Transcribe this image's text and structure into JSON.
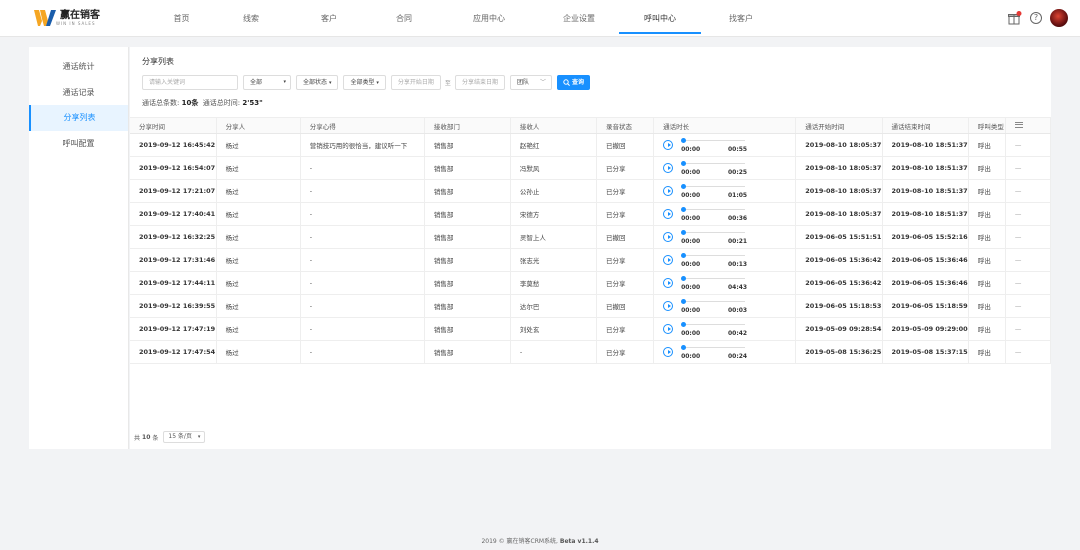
{
  "colors": {
    "accent": "#1890ff",
    "logo_orange": "#f5a623",
    "logo_blue": "#1a5dab"
  },
  "logo": {
    "name": "赢在销客",
    "sub": "WIN IN SALES"
  },
  "nav": [
    {
      "label": "首页"
    },
    {
      "label": "线索"
    },
    {
      "label": "客户"
    },
    {
      "label": "合同"
    },
    {
      "label": "应用中心"
    },
    {
      "label": "企业设置"
    },
    {
      "label": "呼叫中心",
      "active": true
    },
    {
      "label": "找客户"
    }
  ],
  "topbar_icons": [
    "gift-icon",
    "help-icon",
    "avatar"
  ],
  "sidebar": [
    {
      "label": "通话统计"
    },
    {
      "label": "通话记录"
    },
    {
      "label": "分享列表",
      "active": true
    },
    {
      "label": "呼叫配置"
    }
  ],
  "page_title": "分享列表",
  "filters": {
    "keyword_placeholder": "请输入关键词",
    "scope": "全部",
    "status": "全部状态",
    "type": "全部类型",
    "start_date_placeholder": "分享开始日期",
    "to": "至",
    "end_date_placeholder": "分享结束日期",
    "team": "团队",
    "search_button": "查询"
  },
  "summary": {
    "count_label": "通话总条数:",
    "count": "10条",
    "time_label": "通话总时间:",
    "time": "2'53\""
  },
  "table": {
    "headers": [
      "分享时间",
      "分享人",
      "分享心得",
      "接收部门",
      "接收人",
      "录音状态",
      "通话时长",
      "通话开始时间",
      "通话结束时间",
      "呼叫类型"
    ],
    "rows": [
      {
        "time": "2019-09-12 16:45:42",
        "sharer": "杨过",
        "note": "营销技巧用的很恰当，建议听一下",
        "dept": "销售部",
        "receiver": "赵艳红",
        "status": "已撤回",
        "cur": "00:00",
        "dur": "00:55",
        "start": "2019-08-10 18:05:37",
        "end": "2019-08-10 18:51:37",
        "calltype": "呼出",
        "op": "—"
      },
      {
        "time": "2019-09-12 16:54:07",
        "sharer": "杨过",
        "note": "-",
        "dept": "销售部",
        "receiver": "冯默风",
        "status": "已分享",
        "cur": "00:00",
        "dur": "00:25",
        "start": "2019-08-10 18:05:37",
        "end": "2019-08-10 18:51:37",
        "calltype": "呼出",
        "op": "—"
      },
      {
        "time": "2019-09-12 17:21:07",
        "sharer": "杨过",
        "note": "-",
        "dept": "销售部",
        "receiver": "公孙止",
        "status": "已分享",
        "cur": "00:00",
        "dur": "01:05",
        "start": "2019-08-10 18:05:37",
        "end": "2019-08-10 18:51:37",
        "calltype": "呼出",
        "op": "—"
      },
      {
        "time": "2019-09-12 17:40:41",
        "sharer": "杨过",
        "note": "-",
        "dept": "销售部",
        "receiver": "宋德方",
        "status": "已分享",
        "cur": "00:00",
        "dur": "00:36",
        "start": "2019-08-10 18:05:37",
        "end": "2019-08-10 18:51:37",
        "calltype": "呼出",
        "op": "—"
      },
      {
        "time": "2019-09-12 16:32:25",
        "sharer": "杨过",
        "note": "-",
        "dept": "销售部",
        "receiver": "灵智上人",
        "status": "已撤回",
        "cur": "00:00",
        "dur": "00:21",
        "start": "2019-06-05 15:51:51",
        "end": "2019-06-05 15:52:16",
        "calltype": "呼出",
        "op": "—"
      },
      {
        "time": "2019-09-12 17:31:46",
        "sharer": "杨过",
        "note": "-",
        "dept": "销售部",
        "receiver": "张志光",
        "status": "已分享",
        "cur": "00:00",
        "dur": "00:13",
        "start": "2019-06-05 15:36:42",
        "end": "2019-06-05 15:36:46",
        "calltype": "呼出",
        "op": "—"
      },
      {
        "time": "2019-09-12 17:44:11",
        "sharer": "杨过",
        "note": "-",
        "dept": "销售部",
        "receiver": "李莫愁",
        "status": "已分享",
        "cur": "00:00",
        "dur": "04:43",
        "start": "2019-06-05 15:36:42",
        "end": "2019-06-05 15:36:46",
        "calltype": "呼出",
        "op": "—"
      },
      {
        "time": "2019-09-12 16:39:55",
        "sharer": "杨过",
        "note": "-",
        "dept": "销售部",
        "receiver": "达尔巴",
        "status": "已撤回",
        "cur": "00:00",
        "dur": "00:03",
        "start": "2019-06-05 15:18:53",
        "end": "2019-06-05 15:18:59",
        "calltype": "呼出",
        "op": "—"
      },
      {
        "time": "2019-09-12 17:47:19",
        "sharer": "杨过",
        "note": "-",
        "dept": "销售部",
        "receiver": "刘处玄",
        "status": "已分享",
        "cur": "00:00",
        "dur": "00:42",
        "start": "2019-05-09 09:28:54",
        "end": "2019-05-09 09:29:00",
        "calltype": "呼出",
        "op": "—"
      },
      {
        "time": "2019-09-12 17:47:54",
        "sharer": "杨过",
        "note": "-",
        "dept": "销售部",
        "receiver": "-",
        "status": "已分享",
        "cur": "00:00",
        "dur": "00:24",
        "start": "2019-05-08 15:36:25",
        "end": "2019-05-08 15:37:15",
        "calltype": "呼出",
        "op": "—"
      }
    ]
  },
  "pager": {
    "prefix": "共",
    "total": "10",
    "suffix": "条",
    "page_size": "15 条/页"
  },
  "footer": {
    "prefix": "2019 © 赢在销客CRM系统,",
    "version": "Beta v1.1.4"
  }
}
